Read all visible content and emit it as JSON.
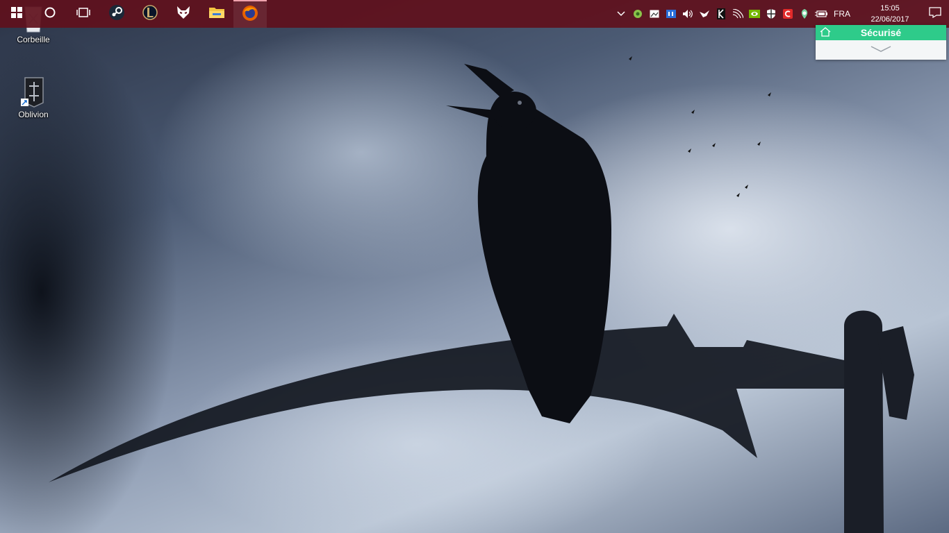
{
  "taskbar": {
    "color": "#5f101c",
    "pinned": [
      {
        "name": "windows-start",
        "icon": "windows-logo-icon"
      },
      {
        "name": "cortana",
        "icon": "circle-search-icon"
      },
      {
        "name": "task-view",
        "icon": "task-view-icon"
      },
      {
        "name": "steam",
        "icon": "steam-icon"
      },
      {
        "name": "league-of-legends",
        "icon": "league-icon"
      },
      {
        "name": "foobar",
        "icon": "fox-mask-icon"
      },
      {
        "name": "file-explorer",
        "icon": "folder-icon"
      },
      {
        "name": "firefox",
        "icon": "firefox-icon",
        "active": true
      }
    ]
  },
  "tray": {
    "language": "FRA",
    "time": "15:05",
    "date": "22/06/2017"
  },
  "desktop": {
    "icons": [
      {
        "label": "Corbeille",
        "icon": "recycle-bin-icon"
      },
      {
        "label": "Oblivion",
        "icon": "oblivion-shortcut-icon"
      }
    ]
  },
  "popup": {
    "status": "Sécurisé",
    "accent": "#2ecb8a"
  }
}
